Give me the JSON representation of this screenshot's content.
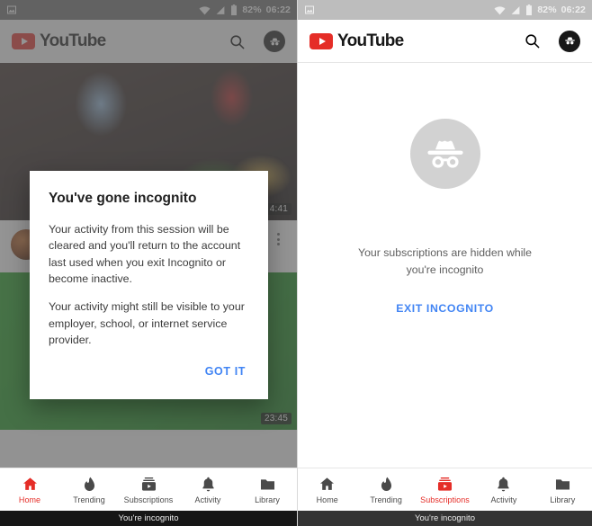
{
  "screens": [
    {
      "id": "home-dialog",
      "statusbar": {
        "battery": "82%",
        "time": "06:22",
        "icons": [
          "image-icon",
          "wifi-icon",
          "signal-icon",
          "battery-icon"
        ]
      },
      "appbar": {
        "logo_text": "YouTube",
        "search_icon": "search-icon",
        "account_icon": "incognito-avatar-icon"
      },
      "feed": [
        {
          "duration": "4:41",
          "title": "",
          "subtitle": ""
        },
        {
          "duration": "23:45",
          "title": "",
          "subtitle": ""
        }
      ],
      "dialog": {
        "title": "You've gone incognito",
        "paragraphs": [
          "Your activity from this session will be cleared and you'll return to the account last used when you exit Incognito or become inactive.",
          "Your activity might still be visible to your employer, school, or internet service provider."
        ],
        "confirm_label": "GOT IT"
      },
      "bottom_nav": {
        "active": "Home",
        "items": [
          {
            "label": "Home",
            "icon": "home-icon"
          },
          {
            "label": "Trending",
            "icon": "flame-icon"
          },
          {
            "label": "Subscriptions",
            "icon": "subscriptions-icon"
          },
          {
            "label": "Activity",
            "icon": "bell-icon"
          },
          {
            "label": "Library",
            "icon": "folder-icon"
          }
        ]
      },
      "incognito_bar": "You're incognito"
    },
    {
      "id": "subscriptions-empty",
      "statusbar": {
        "battery": "82%",
        "time": "06:22",
        "icons": [
          "image-icon",
          "wifi-icon",
          "signal-icon",
          "battery-icon"
        ]
      },
      "appbar": {
        "logo_text": "YouTube",
        "search_icon": "search-icon",
        "account_icon": "incognito-avatar-icon"
      },
      "empty_state": {
        "icon": "incognito-hat-glasses-icon",
        "message": "Your subscriptions are hidden while you're incognito",
        "action_label": "EXIT INCOGNITO"
      },
      "bottom_nav": {
        "active": "Subscriptions",
        "items": [
          {
            "label": "Home",
            "icon": "home-icon"
          },
          {
            "label": "Trending",
            "icon": "flame-icon"
          },
          {
            "label": "Subscriptions",
            "icon": "subscriptions-icon"
          },
          {
            "label": "Activity",
            "icon": "bell-icon"
          },
          {
            "label": "Library",
            "icon": "folder-icon"
          }
        ]
      },
      "incognito_bar": "You're incognito"
    }
  ],
  "colors": {
    "youtube_red": "#e52d27",
    "link_blue": "#4285f4",
    "scrim": "rgba(92,92,92,0.66)",
    "incognito_gray": "#d2d2d2"
  }
}
